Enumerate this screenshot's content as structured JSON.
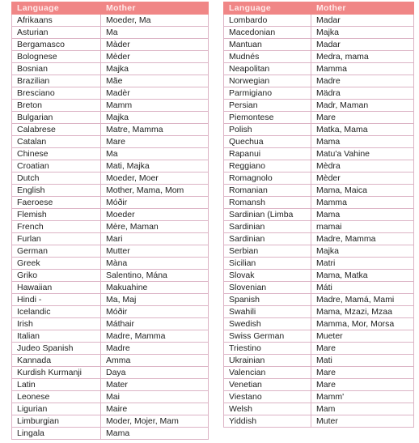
{
  "headers": {
    "language": "Language",
    "mother": "Mother"
  },
  "left": [
    [
      "Afrikaans",
      "Moeder, Ma"
    ],
    [
      "Asturian",
      "Ma"
    ],
    [
      "Bergamasco",
      "Màder"
    ],
    [
      "Bolognese",
      "Mèder"
    ],
    [
      "Bosnian",
      "Majka"
    ],
    [
      "Brazilian",
      "Mãe"
    ],
    [
      "Bresciano",
      "Madèr"
    ],
    [
      "Breton",
      "Mamm"
    ],
    [
      "Bulgarian",
      "Majka"
    ],
    [
      "Calabrese",
      "Matre, Mamma"
    ],
    [
      "Catalan",
      "Mare"
    ],
    [
      "Chinese",
      "Ma"
    ],
    [
      "Croatian",
      "Mati, Majka"
    ],
    [
      "Dutch",
      "Moeder, Moer"
    ],
    [
      "English",
      "Mother, Mama, Mom"
    ],
    [
      "Faeroese",
      "Móðir"
    ],
    [
      "Flemish",
      "Moeder"
    ],
    [
      "French",
      "Mère, Maman"
    ],
    [
      "Furlan",
      "Mari"
    ],
    [
      "German",
      "Mutter"
    ],
    [
      "Greek",
      "Màna"
    ],
    [
      "Griko",
      "Salentino, Mána"
    ],
    [
      "Hawaiian",
      "Makuahine"
    ],
    [
      "Hindi -",
      "Ma, Maj"
    ],
    [
      "Icelandic",
      "Móðir"
    ],
    [
      "Irish",
      "Máthair"
    ],
    [
      "Italian",
      "Madre, Mamma"
    ],
    [
      "Judeo Spanish",
      "Madre"
    ],
    [
      "Kannada",
      "Amma"
    ],
    [
      "Kurdish Kurmanji",
      "Daya"
    ],
    [
      "Latin",
      "Mater"
    ],
    [
      "Leonese",
      "Mai"
    ],
    [
      "Ligurian",
      "Maire"
    ],
    [
      "Limburgian",
      "Moder, Mojer, Mam"
    ],
    [
      "Lingala",
      "Mama"
    ]
  ],
  "right": [
    [
      "Lombardo",
      "Madar"
    ],
    [
      "Macedonian",
      "Majka"
    ],
    [
      "Mantuan",
      "Madar"
    ],
    [
      "Mudnés",
      "Medra, mama"
    ],
    [
      "Neapolitan",
      "Mamma"
    ],
    [
      "Norwegian",
      "Madre"
    ],
    [
      "Parmigiano",
      "Mädra"
    ],
    [
      "Persian",
      "Madr, Maman"
    ],
    [
      "Piemontese",
      "Mare"
    ],
    [
      "Polish",
      "Matka, Mama"
    ],
    [
      "Quechua",
      "Mama"
    ],
    [
      "Rapanui",
      "Matu'a Vahine"
    ],
    [
      "Reggiano",
      "Mèdra"
    ],
    [
      "Romagnolo",
      "Mèder"
    ],
    [
      "Romanian",
      "Mama, Maica"
    ],
    [
      "Romansh",
      "Mamma"
    ],
    [
      "Sardinian (Limba",
      "Mama"
    ],
    [
      "Sardinian",
      "mamai"
    ],
    [
      "Sardinian",
      "Madre, Mamma"
    ],
    [
      "Serbian",
      "Majka"
    ],
    [
      "Sicilian",
      "Matri"
    ],
    [
      "Slovak",
      "Mama, Matka"
    ],
    [
      "Slovenian",
      "Máti"
    ],
    [
      "Spanish",
      "Madre, Mamá, Mami"
    ],
    [
      "Swahili",
      "Mama, Mzazi, Mzaa"
    ],
    [
      "Swedish",
      "Mamma, Mor, Morsa"
    ],
    [
      "Swiss German",
      "Mueter"
    ],
    [
      "Triestino",
      "Mare"
    ],
    [
      "Ukrainian",
      "Mati"
    ],
    [
      "Valencian",
      "Mare"
    ],
    [
      "Venetian",
      "Mare"
    ],
    [
      "Viestano",
      "Mamm'"
    ],
    [
      "Welsh",
      "Mam"
    ],
    [
      "Yiddish",
      "Muter"
    ]
  ]
}
